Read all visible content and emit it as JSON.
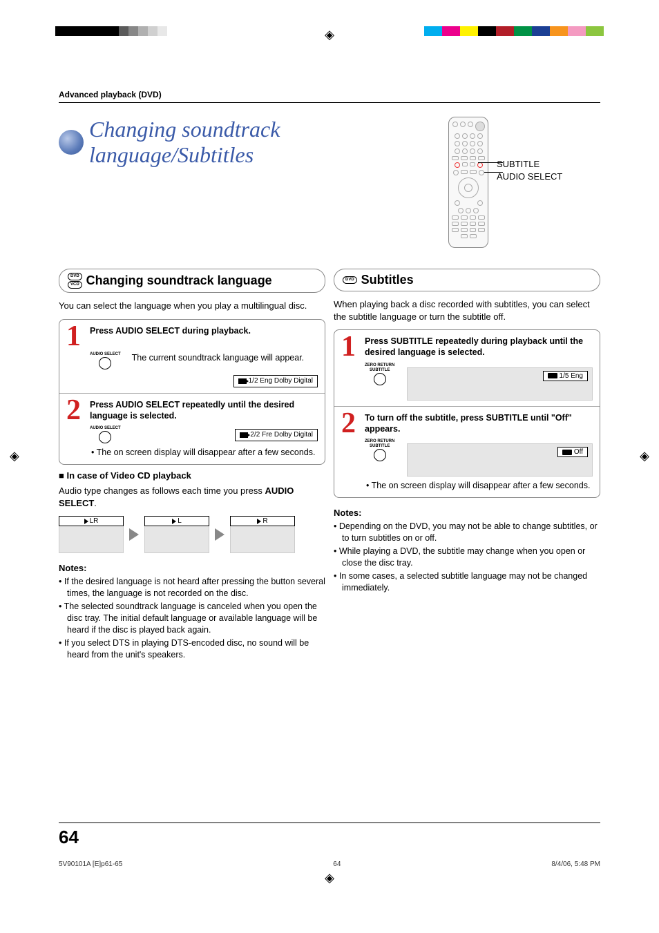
{
  "header": {
    "section_label": "Advanced playback (DVD)",
    "page_title": "Changing soundtrack language/Subtitles"
  },
  "remote_labels": {
    "line1": "SUBTITLE",
    "line2": "AUDIO SELECT"
  },
  "left": {
    "heading": "Changing soundtrack language",
    "disc1": "DVD",
    "disc2": "VCD",
    "intro": "You can select the language when you play a multilingual disc.",
    "step1": {
      "num": "1",
      "title": "Press AUDIO SELECT during playback.",
      "body": "The current soundtrack language will appear.",
      "btn_label": "AUDIO SELECT",
      "osd": "1/2 Eng Dolby Digital"
    },
    "step2": {
      "num": "2",
      "title": "Press AUDIO SELECT repeatedly until the desired language is selected.",
      "btn_label": "AUDIO SELECT",
      "osd": "2/2 Fre Dolby Digital",
      "note": "The on screen display will disappear after a few seconds."
    },
    "vcd": {
      "title": "In case of Video CD playback",
      "intro_a": "Audio type changes as follows each time you press ",
      "intro_b": "AUDIO SELECT",
      "intro_c": ".",
      "box1": "LR",
      "box2": "L",
      "box3": "R"
    },
    "notes_title": "Notes:",
    "notes": [
      "If the desired language is not heard after pressing the button several times, the language is not recorded on the disc.",
      "The selected soundtrack language is canceled when you open the disc tray. The initial default language or available language will be heard if the disc is played back again.",
      "If you select DTS in playing DTS-encoded disc, no sound will be heard from the unit's speakers."
    ]
  },
  "right": {
    "heading": "Subtitles",
    "disc1": "DVD",
    "intro": "When playing back a disc recorded with subtitles, you can select the subtitle language or turn the subtitle off.",
    "step1": {
      "num": "1",
      "title": "Press SUBTITLE repeatedly during playback until the desired language is selected.",
      "btn_label1": "ZERO RETURN",
      "btn_label2": "SUBTITLE",
      "osd": "1/5 Eng"
    },
    "step2": {
      "num": "2",
      "title": "To turn off the subtitle, press SUBTITLE until \"Off\" appears.",
      "btn_label1": "ZERO RETURN",
      "btn_label2": "SUBTITLE",
      "osd": "Off",
      "note": "The on screen display will disappear after a few seconds."
    },
    "notes_title": "Notes:",
    "notes": [
      "Depending on the DVD, you may not be able to change subtitles, or to turn subtitles on or off.",
      "While playing a DVD, the subtitle may change when you open or close the disc tray.",
      "In some cases, a selected subtitle language may not be changed immediately."
    ]
  },
  "footer": {
    "page_num": "64",
    "file": "5V90101A [E]p61-65",
    "center": "64",
    "date": "8/4/06, 5:48 PM"
  },
  "print_colors": {
    "left": [
      "#000",
      "#000",
      "#000",
      "#000",
      "#5a5a5a",
      "#878787",
      "#b0b0b0",
      "#d0d0d0",
      "#e8e8e8"
    ],
    "right": [
      "#00aeef",
      "#ec008c",
      "#fff200",
      "#000",
      "#b21e28",
      "#009245",
      "#1b3f94",
      "#f7941d",
      "#f49ac1",
      "#8cc63f"
    ]
  }
}
